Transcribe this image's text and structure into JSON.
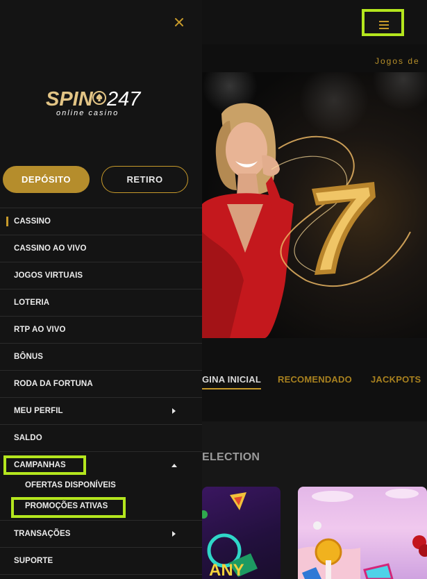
{
  "colors": {
    "accent_gold": "#c79a2b",
    "highlight_green": "#b4e61e",
    "drawer_bg": "#141414"
  },
  "header": {
    "menu_icon": "hamburger-icon",
    "marquee_text": "Jogos de"
  },
  "tabs": [
    {
      "label": "GINA INICIAL",
      "active": true
    },
    {
      "label": "RECOMENDADO",
      "active": false
    },
    {
      "label": "JACKPOTS",
      "active": false
    }
  ],
  "section": {
    "title": "ELECTION"
  },
  "drawer": {
    "close_icon": "close-icon",
    "logo": {
      "brand": "SPIN",
      "number": "247",
      "tagline": "online casino"
    },
    "deposit_label": "DEPÓSITO",
    "withdraw_label": "RETIRO",
    "items": [
      {
        "label": "CASSINO",
        "active": true
      },
      {
        "label": "CASSINO AO VIVO"
      },
      {
        "label": "JOGOS VIRTUAIS"
      },
      {
        "label": "LOTERIA"
      },
      {
        "label": "RTP AO VIVO"
      },
      {
        "label": "BÔNUS"
      },
      {
        "label": "RODA DA FORTUNA"
      },
      {
        "label": "MEU PERFIL",
        "caret": "right"
      },
      {
        "label": "SALDO"
      },
      {
        "label": "CAMPANHAS",
        "caret": "up",
        "expanded": true
      },
      {
        "label": "TRANSAÇÕES",
        "caret": "right"
      },
      {
        "label": "SUPORTE"
      }
    ],
    "campanhas_sub": [
      {
        "label": "OFERTAS DISPONÍVEIS"
      },
      {
        "label": "PROMOÇÕES ATIVAS"
      }
    ]
  }
}
